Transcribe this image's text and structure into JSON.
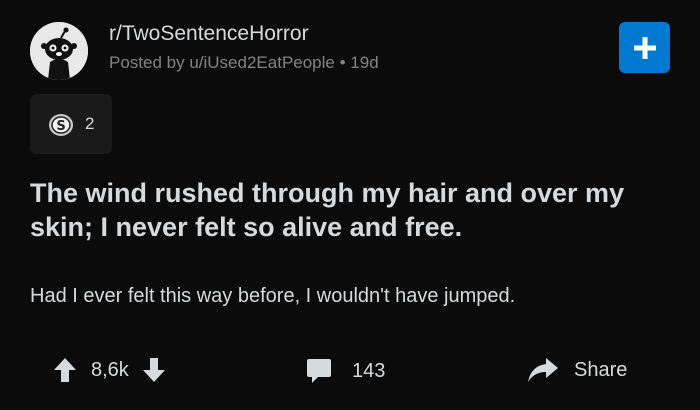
{
  "post": {
    "subreddit": "r/TwoSentenceHorror",
    "posted_by": "Posted by u/iUsed2EatPeople",
    "separator": "•",
    "age": "19d",
    "award_count": "2",
    "title": "The wind rushed through my hair and over my skin; I never felt so alive and free.",
    "body": "Had I ever felt this way before, I wouldn't have jumped."
  },
  "actions": {
    "score": "8,6k",
    "comments": "143",
    "share_label": "Share"
  },
  "colors": {
    "background": "#0b0b0b",
    "accent": "#0079d3",
    "text": "#d7dadc",
    "muted": "#818384"
  },
  "icons": {
    "avatar": "subreddit-avatar-icon",
    "join": "plus-icon",
    "award": "silver-award-icon",
    "upvote": "arrow-up-icon",
    "downvote": "arrow-down-icon",
    "comment": "comment-bubble-icon",
    "share": "share-arrow-icon"
  }
}
